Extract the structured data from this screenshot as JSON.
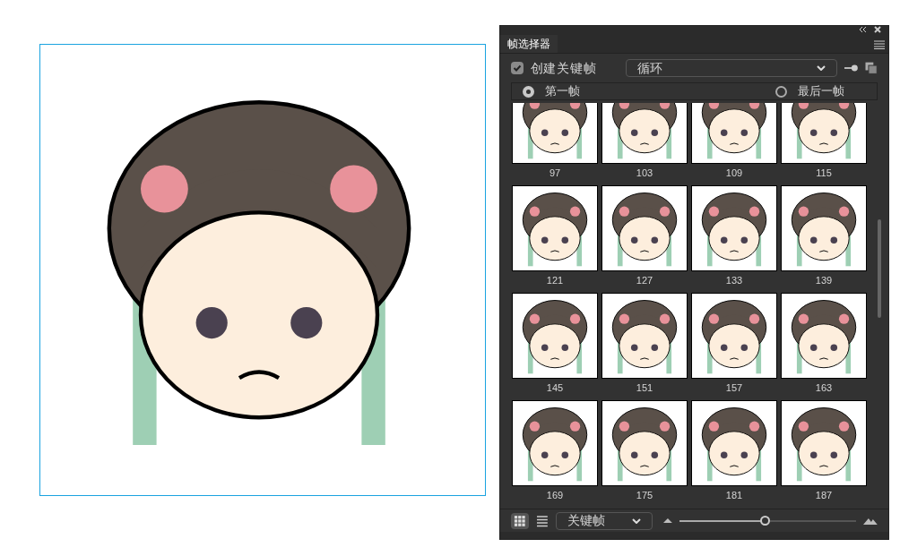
{
  "panel": {
    "title": "帧选择器",
    "create_keyframe": {
      "label": "创建关键帧",
      "checked": true
    },
    "loop_mode": {
      "value": "循环"
    },
    "frame_options": [
      {
        "label": "第一帧",
        "selected": true
      },
      {
        "label": "最后一帧",
        "selected": false
      }
    ],
    "frames": [
      {
        "label": "97"
      },
      {
        "label": "103"
      },
      {
        "label": "109"
      },
      {
        "label": "115"
      },
      {
        "label": "121"
      },
      {
        "label": "127"
      },
      {
        "label": "133"
      },
      {
        "label": "139"
      },
      {
        "label": "145"
      },
      {
        "label": "151"
      },
      {
        "label": "157"
      },
      {
        "label": "163"
      },
      {
        "label": "169"
      },
      {
        "label": "175"
      },
      {
        "label": "181"
      },
      {
        "label": "187"
      }
    ],
    "view": {
      "grid_selected": true
    },
    "filter": {
      "value": "关键帧"
    },
    "thumbnail_size": {
      "level": 0.48
    }
  }
}
